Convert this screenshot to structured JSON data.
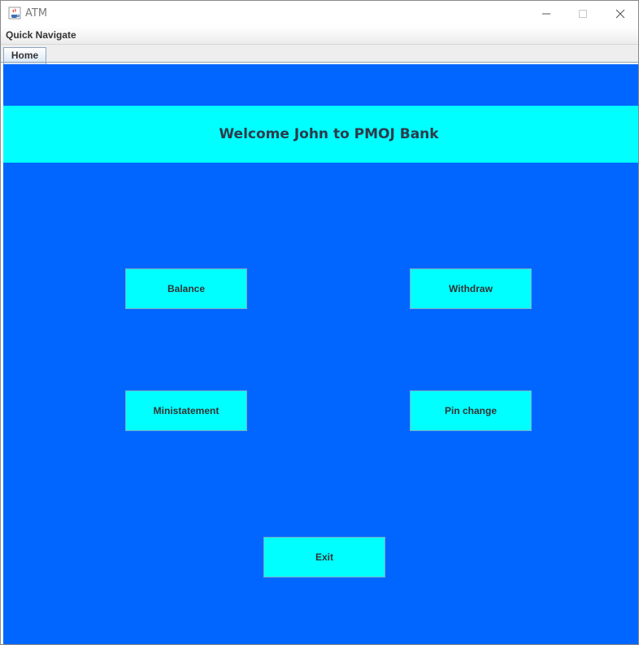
{
  "window": {
    "title": "ATM",
    "icon": "java-coffee-icon"
  },
  "menubar": {
    "items": [
      {
        "label": "Quick Navigate"
      }
    ]
  },
  "tabs": [
    {
      "label": "Home",
      "selected": true
    }
  ],
  "main": {
    "welcome": "Welcome John to PMOJ Bank",
    "buttons": {
      "balance": "Balance",
      "withdraw": "Withdraw",
      "ministatement": "Ministatement",
      "pin_change": "Pin change",
      "exit": "Exit"
    }
  },
  "colors": {
    "content_background": "#0066ff",
    "banner_and_buttons": "#00ffff"
  }
}
